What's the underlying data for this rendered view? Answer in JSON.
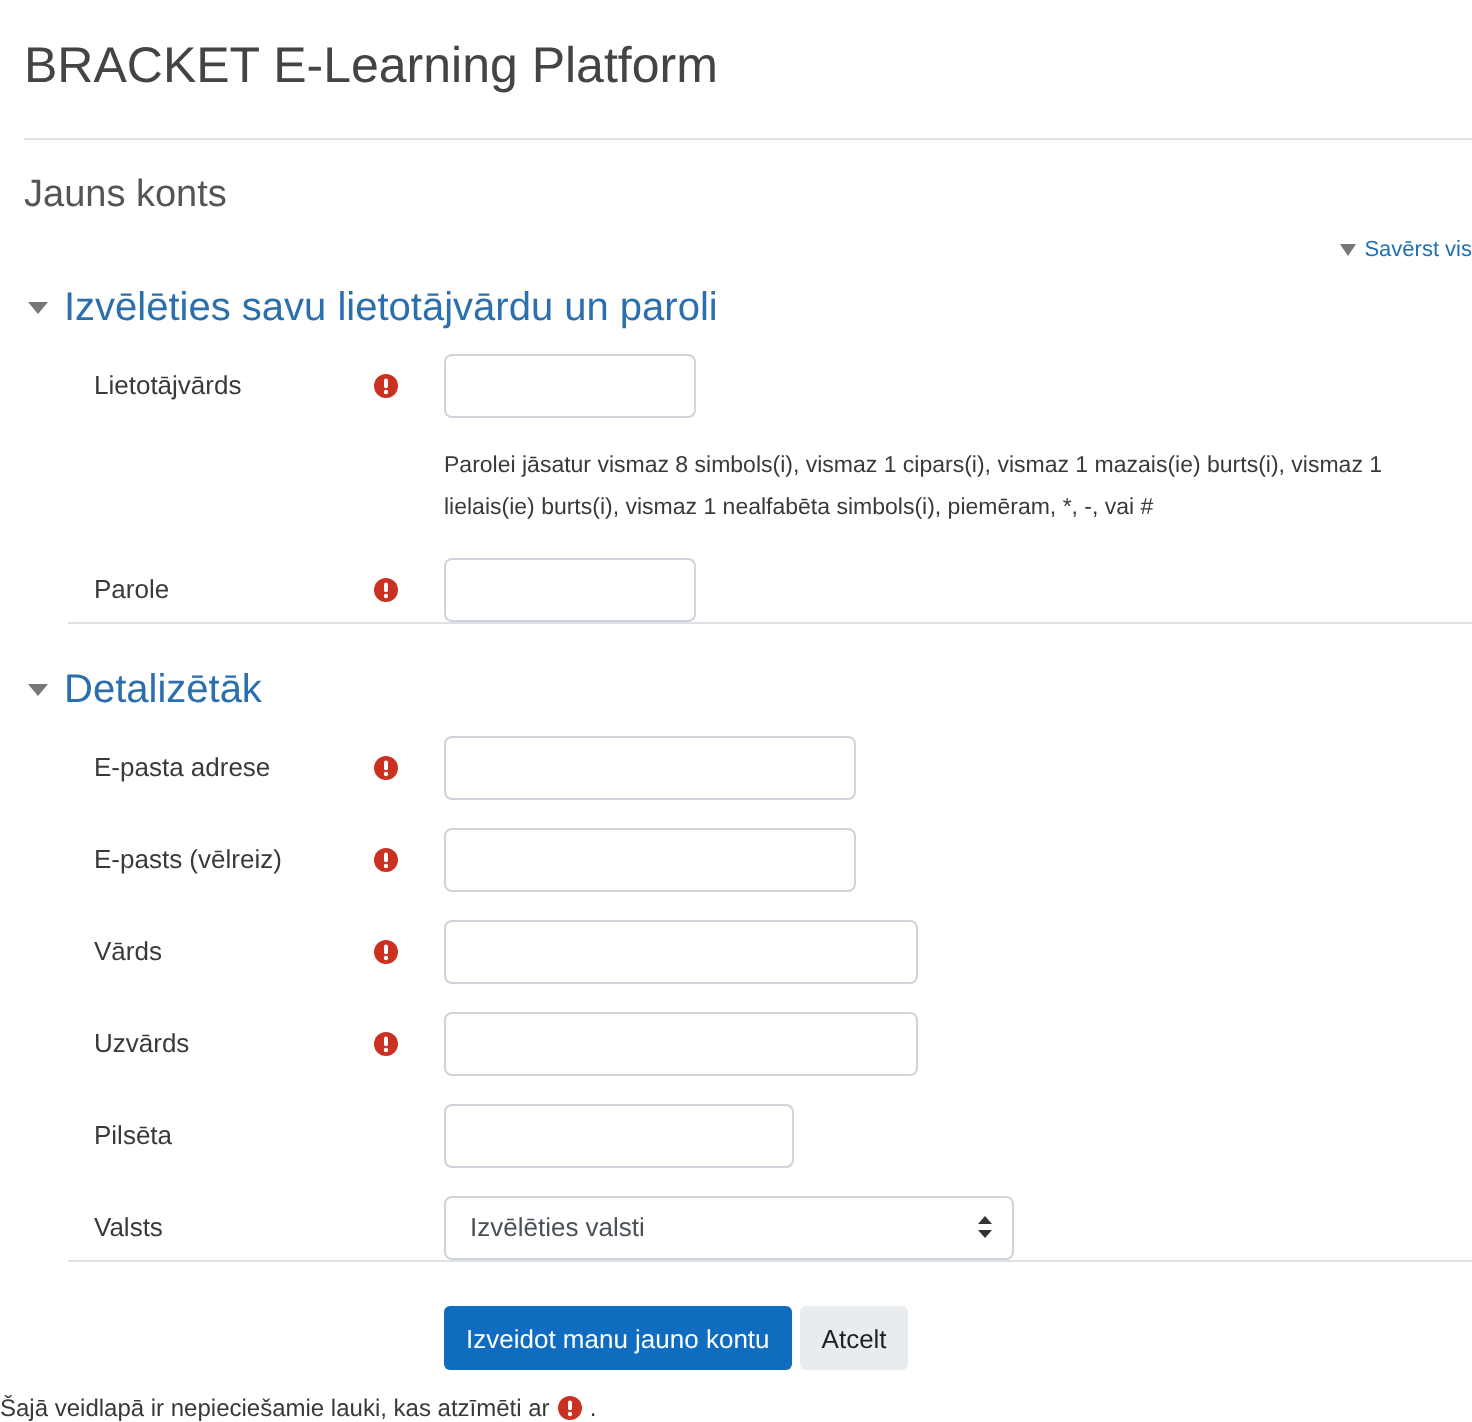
{
  "site_title": "BRACKET E-Learning Platform",
  "page_heading": "Jauns konts",
  "collapse_all_link": "Savērst vis",
  "sections": [
    {
      "title": "Izvēlēties savu lietotājvārdu un paroli",
      "expanded": true,
      "fields": [
        {
          "kind": "text",
          "label": "Lietotājvārds",
          "required": true
        },
        {
          "kind": "note",
          "text": "Parolei jāsatur vismaz 8 simbols(i), vismaz 1 cipars(i), vismaz 1 mazais(ie) burts(i), vismaz 1 lielais(ie) burts(i), vismaz 1 nealfabēta simbols(i), piemēram, *, -, vai #"
        },
        {
          "kind": "text",
          "label": "Parole",
          "required": true
        }
      ]
    },
    {
      "title": "Detalizētāk",
      "expanded": true,
      "fields": [
        {
          "kind": "text",
          "label": "E-pasta adrese",
          "required": true
        },
        {
          "kind": "text",
          "label": "E-pasts (vēlreiz)",
          "required": true
        },
        {
          "kind": "text",
          "label": "Vārds",
          "required": true
        },
        {
          "kind": "text",
          "label": "Uzvārds",
          "required": true
        },
        {
          "kind": "text",
          "label": "Pilsēta",
          "required": false
        },
        {
          "kind": "select",
          "label": "Valsts",
          "required": false,
          "value": "Izvēlēties valsti"
        }
      ]
    }
  ],
  "buttons": [
    {
      "label": "Izveidot manu jauno kontu",
      "kind": "primary"
    },
    {
      "label": "Atcelt",
      "kind": "secondary"
    }
  ],
  "footer_note": {
    "before": "Šajā veidlapā ir nepieciešamie lauki, kas atzīmēti ar",
    "after": "."
  }
}
